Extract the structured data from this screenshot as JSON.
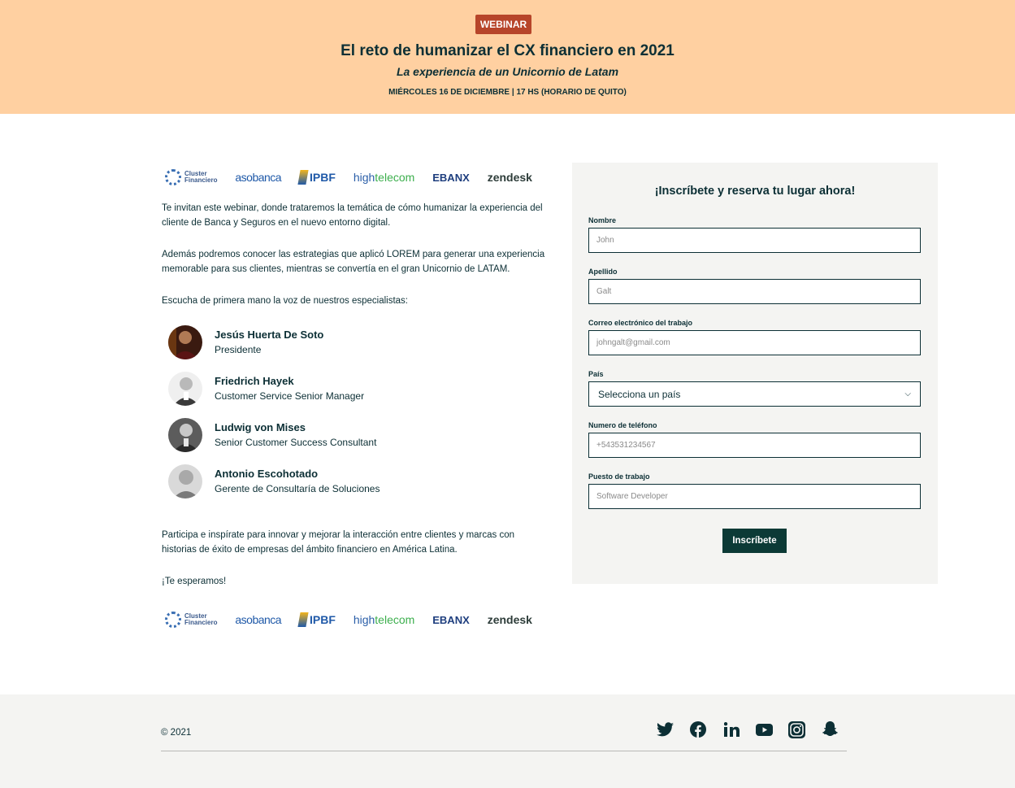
{
  "banner": {
    "badge": "WEBINAR",
    "title": "El reto de humanizar el CX financiero en 2021",
    "subtitle": "La experiencia de un Unicornio de Latam",
    "date": "MIÉRCOLES 16 DE DICIEMBRE | 17 HS (HORARIO DE QUITO)",
    "bg_color": "#ffd0a1",
    "badge_color": "#b7452a"
  },
  "sponsors": {
    "cluster_line1": "Cluster",
    "cluster_line2": "Financiero",
    "asobanca": "asobanca",
    "ipbf": "IPBF",
    "hightelecom_a": "high",
    "hightelecom_b": "telecom",
    "ebanx": "EBANX",
    "zendesk": "zendesk"
  },
  "intro": {
    "p1": "Te invitan este webinar, donde trataremos la temática de cómo humanizar la experiencia del cliente de Banca y Seguros en el nuevo entorno digital.",
    "p2": "Además podremos conocer las estrategias que aplicó LOREM para generar una experiencia memorable para sus clientes, mientras se convertía en el gran Unicornio de LATAM.",
    "p3": "Escucha de primera mano la voz de nuestros especialistas:"
  },
  "speakers": [
    {
      "name": "Jesús Huerta De Soto",
      "role": "Presidente"
    },
    {
      "name": "Friedrich Hayek",
      "role": "Customer Service Senior Manager"
    },
    {
      "name": "Ludwig von Mises",
      "role": "Senior Customer Success Consultant"
    },
    {
      "name": "Antonio Escohotado",
      "role": "Gerente de Consultaría de Soluciones"
    }
  ],
  "outro": {
    "p1": "Participa e inspírate para innovar y mejorar la interacción entre clientes y marcas con historias de éxito de empresas del ámbito financiero en América Latina.",
    "p2": "¡Te esperamos!"
  },
  "form": {
    "title": "¡Inscríbete y reserva tu lugar ahora!",
    "first_name_label": "Nombre",
    "first_name_placeholder": "John",
    "last_name_label": "Apellido",
    "last_name_placeholder": "Galt",
    "email_label": "Correo electrónico del trabajo",
    "email_placeholder": "johngalt@gmail.com",
    "country_label": "País",
    "country_value": "Selecciona un país",
    "phone_label": "Numero de teléfono",
    "phone_placeholder": "+543531234567",
    "job_label": "Puesto de trabajo",
    "job_placeholder": "Software Developer",
    "submit_label": "Inscríbete",
    "submit_color": "#0c3a36"
  },
  "footer": {
    "copyright": "© 2021",
    "social_icons": [
      "twitter-icon",
      "facebook-icon",
      "linkedin-icon",
      "youtube-icon",
      "instagram-icon",
      "snapchat-icon"
    ]
  }
}
